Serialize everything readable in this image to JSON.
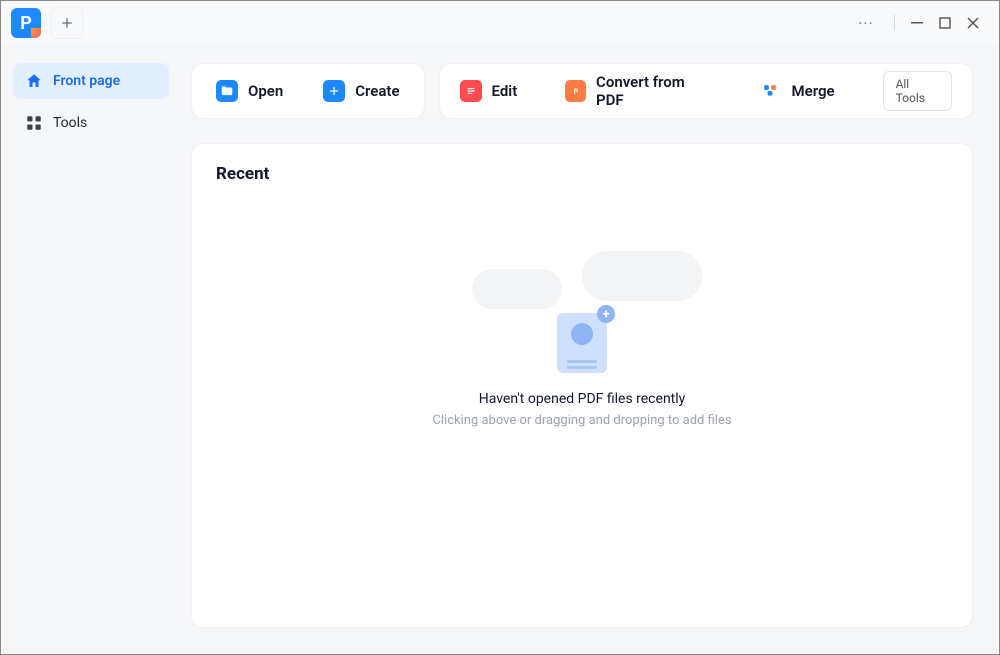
{
  "titlebar": {
    "logo_letter": "P"
  },
  "sidebar": {
    "front_page_label": "Front page",
    "tools_label": "Tools"
  },
  "actions": {
    "open_label": "Open",
    "create_label": "Create",
    "edit_label": "Edit",
    "convert_label": "Convert from PDF",
    "merge_label": "Merge",
    "all_tools_label": "All Tools"
  },
  "recent": {
    "heading": "Recent",
    "empty_title": "Haven't opened PDF files recently",
    "empty_subtitle": "Clicking above or dragging and dropping to add files"
  },
  "colors": {
    "accent_blue": "#1a6dff",
    "open_icon": "#1e88ff",
    "create_icon": "#1e88ff",
    "edit_icon": "#ff4d4f",
    "convert_icon": "#ff7a45",
    "merge_icon": "#1e88ff"
  }
}
